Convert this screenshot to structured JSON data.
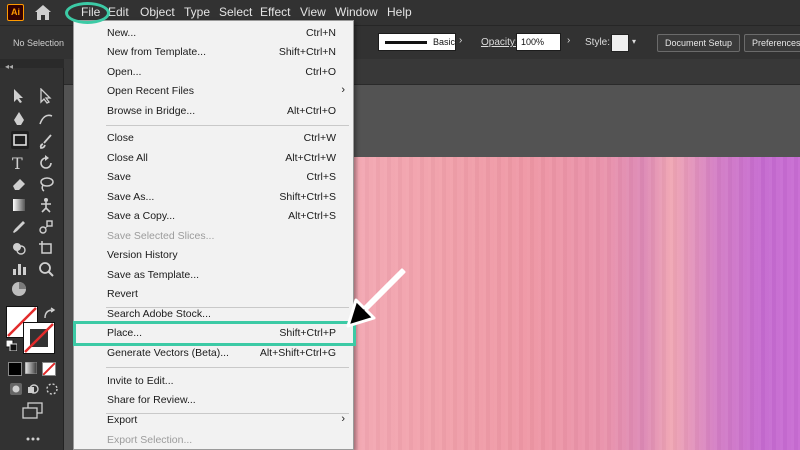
{
  "app": {
    "logo_text": "Ai"
  },
  "menubar": {
    "items": [
      "File",
      "Edit",
      "Object",
      "Type",
      "Select",
      "Effect",
      "View",
      "Window",
      "Help"
    ]
  },
  "control": {
    "selection_label": "No Selection",
    "stroke_profile": "Basic",
    "opacity_label": "Opacity:",
    "opacity_value": "100%",
    "style_label": "Style:",
    "document_setup": "Document Setup",
    "preferences": "Preferences"
  },
  "file_menu": {
    "items": [
      {
        "label": "New...",
        "shortcut": "Ctrl+N"
      },
      {
        "label": "New from Template...",
        "shortcut": "Shift+Ctrl+N"
      },
      {
        "label": "Open...",
        "shortcut": "Ctrl+O"
      },
      {
        "label": "Open Recent Files",
        "shortcut": ""
      },
      {
        "label": "Browse in Bridge...",
        "shortcut": "Alt+Ctrl+O"
      },
      {
        "label": "Close",
        "shortcut": "Ctrl+W"
      },
      {
        "label": "Close All",
        "shortcut": "Alt+Ctrl+W"
      },
      {
        "label": "Save",
        "shortcut": "Ctrl+S"
      },
      {
        "label": "Save As...",
        "shortcut": "Shift+Ctrl+S"
      },
      {
        "label": "Save a Copy...",
        "shortcut": "Alt+Ctrl+S"
      },
      {
        "label": "Save Selected Slices...",
        "shortcut": ""
      },
      {
        "label": "Version History",
        "shortcut": ""
      },
      {
        "label": "Save as Template...",
        "shortcut": ""
      },
      {
        "label": "Revert",
        "shortcut": ""
      },
      {
        "label": "Search Adobe Stock...",
        "shortcut": ""
      },
      {
        "label": "Place...",
        "shortcut": "Shift+Ctrl+P"
      },
      {
        "label": "Generate Vectors (Beta)...",
        "shortcut": "Alt+Shift+Ctrl+G"
      },
      {
        "label": "Invite to Edit...",
        "shortcut": ""
      },
      {
        "label": "Share for Review...",
        "shortcut": ""
      },
      {
        "label": "Export",
        "shortcut": ""
      },
      {
        "label": "Export Selection...",
        "shortcut": ""
      }
    ]
  },
  "colors": {
    "highlight": "#3ccaa5",
    "menu_bg": "#f2f2f2",
    "app_bg": "#323232"
  }
}
